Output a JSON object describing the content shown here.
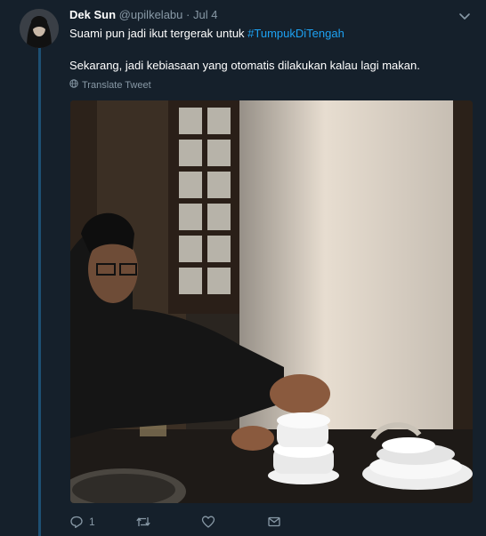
{
  "tweet": {
    "display_name": "Dek Sun",
    "handle": "@upilkelabu",
    "separator": "·",
    "time": "Jul 4",
    "line1_text": "Suami pun jadi ikut tergerak untuk ",
    "hashtag": "#TumpukDiTengah",
    "line2_text": "Sekarang, jadi kebiasaan yang otomatis dilakukan kalau lagi makan.",
    "translate_label": "Translate Tweet",
    "reply_count": "1",
    "retweet_count": "",
    "like_count": ""
  },
  "icons": {
    "caret": "chevron-down-icon",
    "translate": "globe-icon",
    "reply": "reply-icon",
    "retweet": "retweet-icon",
    "like": "heart-icon",
    "dm": "envelope-icon"
  },
  "colors": {
    "background": "#15202b",
    "accent": "#1da1f2",
    "muted": "#8899a6",
    "thread_line": "#1d4f73"
  }
}
